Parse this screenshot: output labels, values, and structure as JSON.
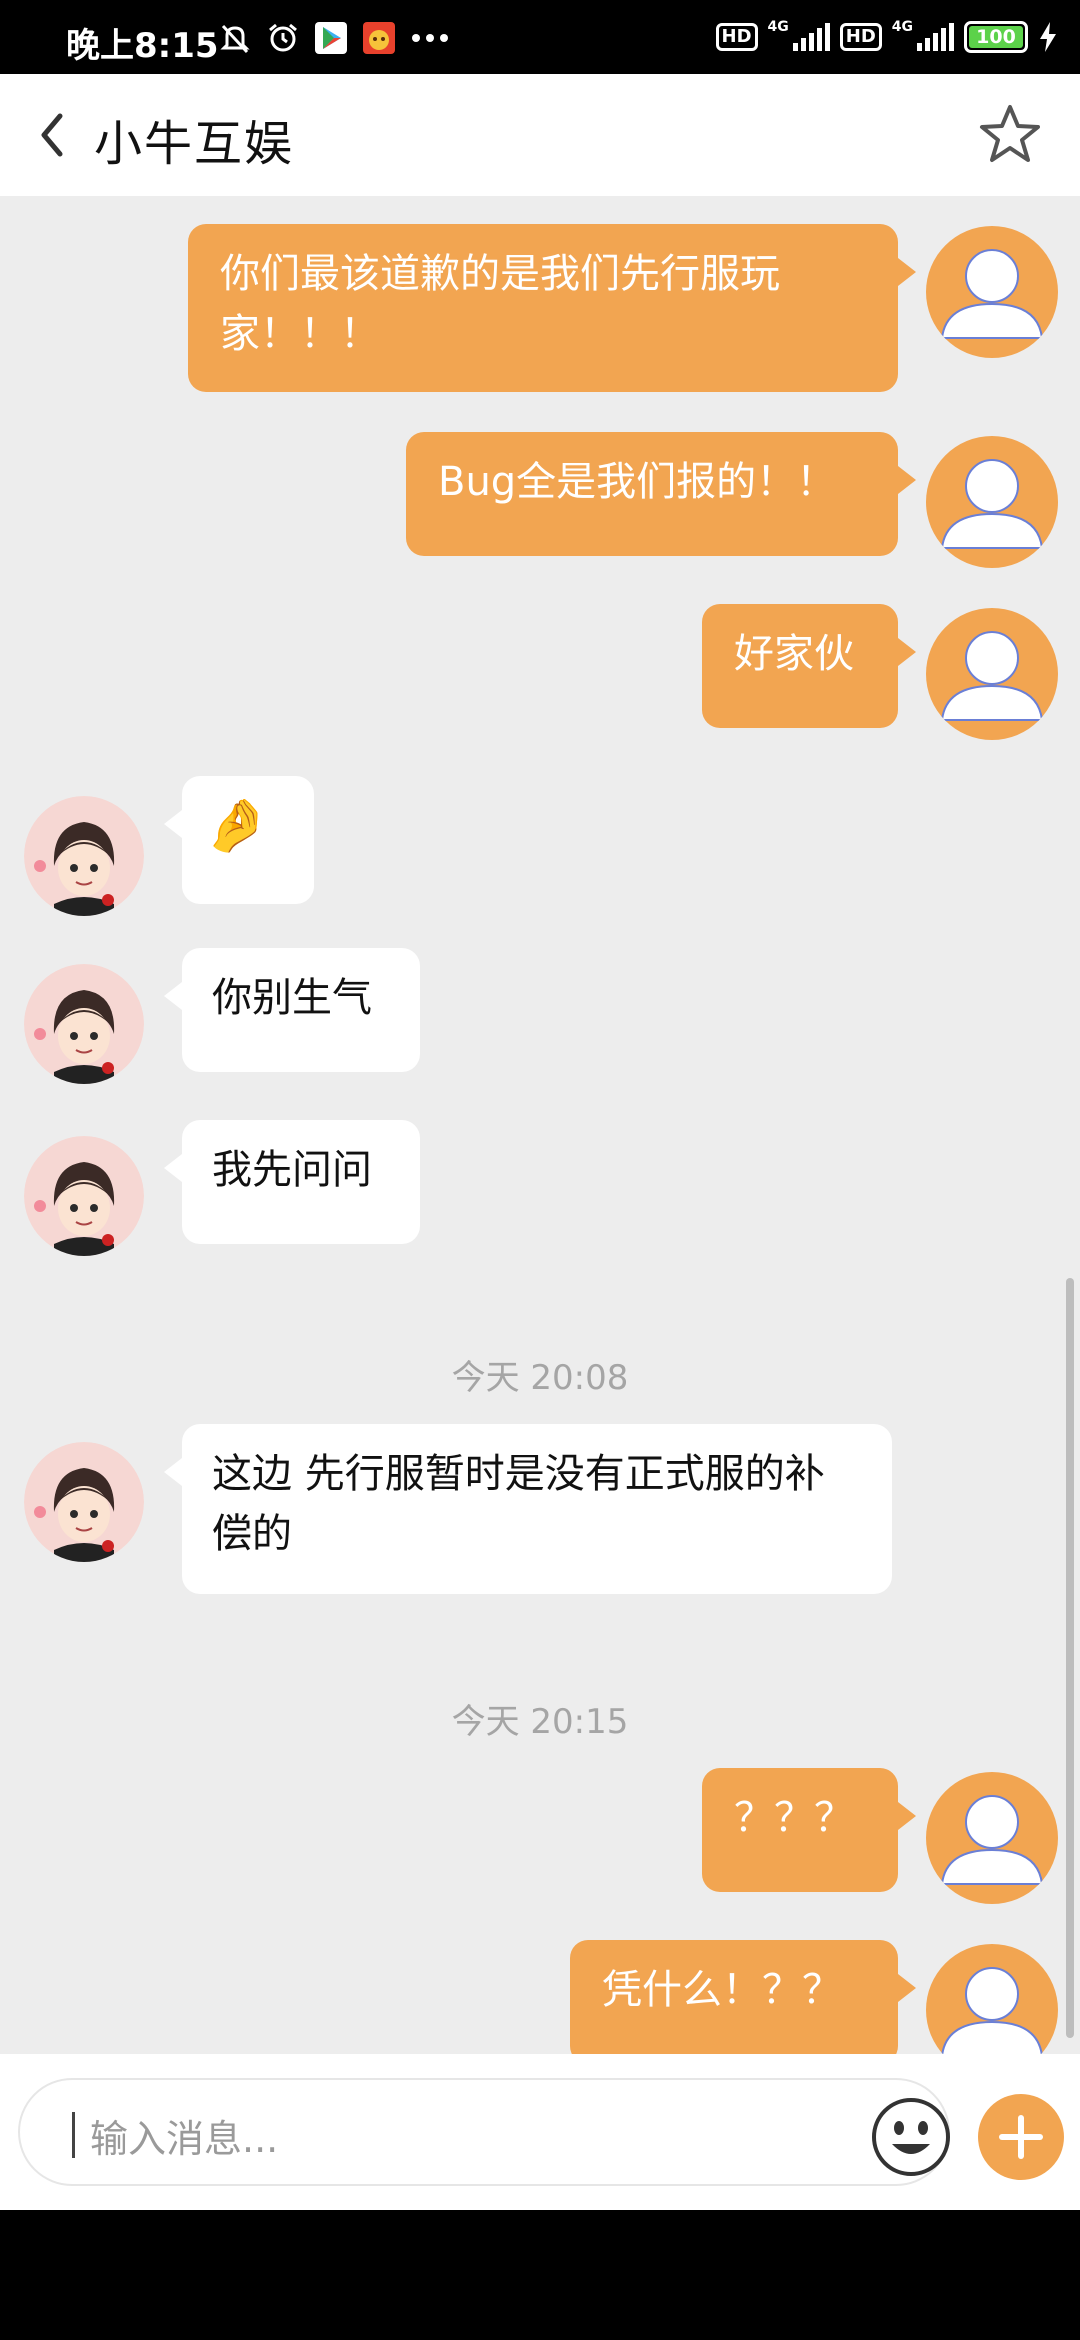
{
  "status_bar": {
    "time": "晚上8:15",
    "hd1": "HD",
    "hd2": "HD",
    "net1": "4G",
    "net2": "4G",
    "battery": "100"
  },
  "header": {
    "title": "小牛互娱"
  },
  "colors": {
    "accent": "#f2a551",
    "chat_bg": "#ededed"
  },
  "messages": [
    {
      "side": "out",
      "text": "你们最该道歉的是我们先行服玩家！！！"
    },
    {
      "side": "out",
      "text": "Bug全是我们报的！！"
    },
    {
      "side": "out",
      "text": "好家伙"
    },
    {
      "side": "in",
      "text": "🤌"
    },
    {
      "side": "in",
      "text": "你别生气"
    },
    {
      "side": "in",
      "text": "我先问问"
    },
    {
      "side": "time",
      "text": "今天 20:08"
    },
    {
      "side": "in",
      "text": "这边 先行服暂时是没有正式服的补偿的"
    },
    {
      "side": "time",
      "text": "今天 20:15"
    },
    {
      "side": "out",
      "text": "？？？"
    },
    {
      "side": "out",
      "text": "凭什么！？？"
    }
  ],
  "input": {
    "placeholder": "输入消息..."
  }
}
